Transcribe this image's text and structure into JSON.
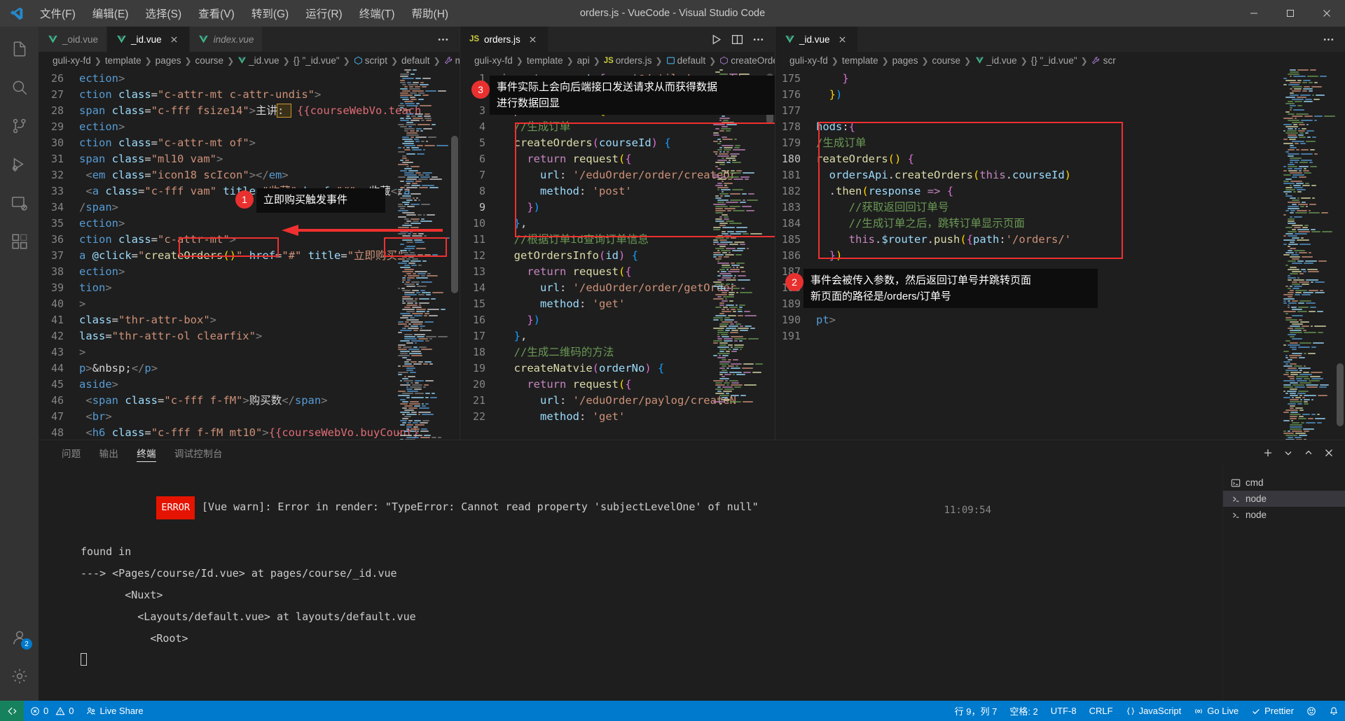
{
  "window": {
    "title": "orders.js - VueCode - Visual Studio Code",
    "menus": [
      "文件(F)",
      "编辑(E)",
      "选择(S)",
      "查看(V)",
      "转到(G)",
      "运行(R)",
      "终端(T)",
      "帮助(H)"
    ],
    "controls": {
      "minimize": "minimize-icon",
      "maximize": "maximize-icon",
      "close": "close-icon"
    }
  },
  "activitybar": {
    "items": [
      {
        "name": "explorer",
        "icon": "files-icon",
        "badge": ""
      },
      {
        "name": "search",
        "icon": "search-icon",
        "badge": ""
      },
      {
        "name": "source-control",
        "icon": "source-control-icon",
        "badge": ""
      },
      {
        "name": "run-and-debug",
        "icon": "debug-icon",
        "badge": ""
      },
      {
        "name": "remote-explorer",
        "icon": "remote-explorer-icon",
        "badge": ""
      },
      {
        "name": "extensions",
        "icon": "extensions-icon",
        "badge": ""
      }
    ],
    "bottom": [
      {
        "name": "accounts",
        "icon": "account-icon",
        "badge": "2"
      },
      {
        "name": "settings",
        "icon": "gear-icon",
        "badge": ""
      }
    ]
  },
  "groups": [
    {
      "id": "group-1",
      "tabs": [
        {
          "label": "_oid.vue",
          "icon": "vue-icon",
          "active": false,
          "preview": false,
          "closable": false
        },
        {
          "label": "_id.vue",
          "icon": "vue-icon",
          "active": true,
          "preview": false,
          "closable": true
        },
        {
          "label": "index.vue",
          "icon": "vue-icon",
          "active": false,
          "preview": true,
          "closable": false
        }
      ],
      "actions": [
        "more-actions-icon"
      ],
      "breadcrumb": [
        "guli-xy-fd",
        "template",
        "pages",
        "course",
        "_id.vue",
        "{} \"_id.vue\"",
        "script",
        "default",
        "m"
      ],
      "first_line": 26,
      "lines": [
        "ection>",
        "ction class=\"c-attr-mt c-attr-undis\">",
        "span class=\"c-fff fsize14\">主讲: {{courseWebVo.teach",
        "ection>",
        "ction class=\"c-attr-mt of\">",
        "span class=\"ml10 vam\">",
        " <em class=\"icon18 scIcon\"></em>",
        " <a class=\"c-fff vam\" title=\"收藏\" href=\"#\" >收藏</a",
        "/span>",
        "ection>",
        "ction class=\"c-attr-mt\">",
        "a @click=\"createOrders()\" href=\"#\" title=\"立即购买\"",
        "ection>",
        "tion>",
        ">",
        "class=\"thr-attr-box\">",
        "lass=\"thr-attr-ol clearfix\">",
        ">",
        "p>&nbsp;</p>",
        "aside>",
        " <span class=\"c-fff f-fM\">购买数</span>",
        " <br>",
        " <h6 class=\"c-fff f-fM mt10\">{{courseWebVo.buyCount}}"
      ]
    },
    {
      "id": "group-2",
      "tabs": [
        {
          "label": "orders.js",
          "icon": "js-icon",
          "active": true,
          "preview": false,
          "closable": true
        }
      ],
      "actions": [
        "run-icon",
        "split-editor-icon",
        "more-actions-icon"
      ],
      "breadcrumb": [
        "guli-xy-fd",
        "template",
        "api",
        "orders.js",
        "default",
        "createOrders"
      ],
      "first_line": 1,
      "lines": [
        "import request from '@/utils/request'",
        "",
        "export default {",
        "  //生成订单",
        "  createOrders(courseId) {",
        "    return request({",
        "      url: '/eduOrder/order/createOr",
        "      method: 'post'",
        "    })",
        "  },",
        "  //根据订单id查询订单信息",
        "  getOrdersInfo(id) {",
        "    return request({",
        "      url: '/eduOrder/order/getOrder",
        "      method: 'get'",
        "    })",
        "  },",
        "  //生成二维码的方法",
        "  createNatvie(orderNo) {",
        "    return request({",
        "      url: '/eduOrder/paylog/createN",
        "      method: 'get'"
      ]
    },
    {
      "id": "group-3",
      "tabs": [
        {
          "label": "_id.vue",
          "icon": "vue-icon",
          "active": true,
          "preview": false,
          "closable": true
        }
      ],
      "actions": [
        "more-actions-icon"
      ],
      "breadcrumb": [
        "guli-xy-fd",
        "template",
        "pages",
        "course",
        "_id.vue",
        "{} \"_id.vue\"",
        "scr"
      ],
      "first_line": 175,
      "lines": [
        "    }",
        "  })",
        "",
        "hods:{",
        "/生成订单",
        "reateOrders() {",
        "  ordersApi.createOrders(this.courseId)",
        "  .then(response => {",
        "     //获取返回回订单号",
        "     //生成订单之后，跳转订单显示页面",
        "     this.$router.push({path:'/orders/'",
        "  })",
        "",
        "",
        "",
        "pt>",
        ""
      ]
    }
  ],
  "annotations": [
    {
      "number": "1",
      "text": "立即购买触发事件"
    },
    {
      "number": "2",
      "text": "事件会被传入参数，然后返回订单号并跳转页面\n新页面的路径是/orders/订单号"
    },
    {
      "number": "3",
      "text": "事件实际上会向后端接口发送请求从而获得数据\n进行数据回显"
    }
  ],
  "panel": {
    "tabs": [
      "问题",
      "输出",
      "终端",
      "调试控制台"
    ],
    "active_tab": "终端",
    "actions": [
      "add-terminal-icon",
      "chevron-down-icon",
      "maximize-panel-icon",
      "close-panel-icon"
    ],
    "terminal": {
      "error_badge": "ERROR",
      "timestamp": "11:09:54",
      "lines": [
        "[Vue warn]: Error in render: \"TypeError: Cannot read property 'subjectLevelOne' of null\"",
        "",
        "found in",
        "",
        "---> <Pages/course/Id.vue> at pages/course/_id.vue",
        "       <Nuxt>",
        "         <Layouts/default.vue> at layouts/default.vue",
        "           <Root>"
      ]
    },
    "terminal_list": [
      {
        "label": "cmd",
        "icon": "terminal-cmd-icon",
        "active": false
      },
      {
        "label": "node",
        "icon": "terminal-node-icon",
        "active": true
      },
      {
        "label": "node",
        "icon": "terminal-node-icon",
        "active": false
      }
    ]
  },
  "statusbar": {
    "remote_label": "",
    "errors": "0",
    "warnings": "0",
    "live_share": "Live Share",
    "cursor_position": "行 9，列 7",
    "indentation": "空格: 2",
    "encoding": "UTF-8",
    "eol": "CRLF",
    "language": "JavaScript",
    "go_live": "Go Live",
    "prettier": "Prettier",
    "bell": "bell-icon"
  },
  "colors": {
    "accent": "#007acc",
    "annotation_red": "#f03030",
    "error_red": "#e51400",
    "remote_green": "#16825d"
  }
}
